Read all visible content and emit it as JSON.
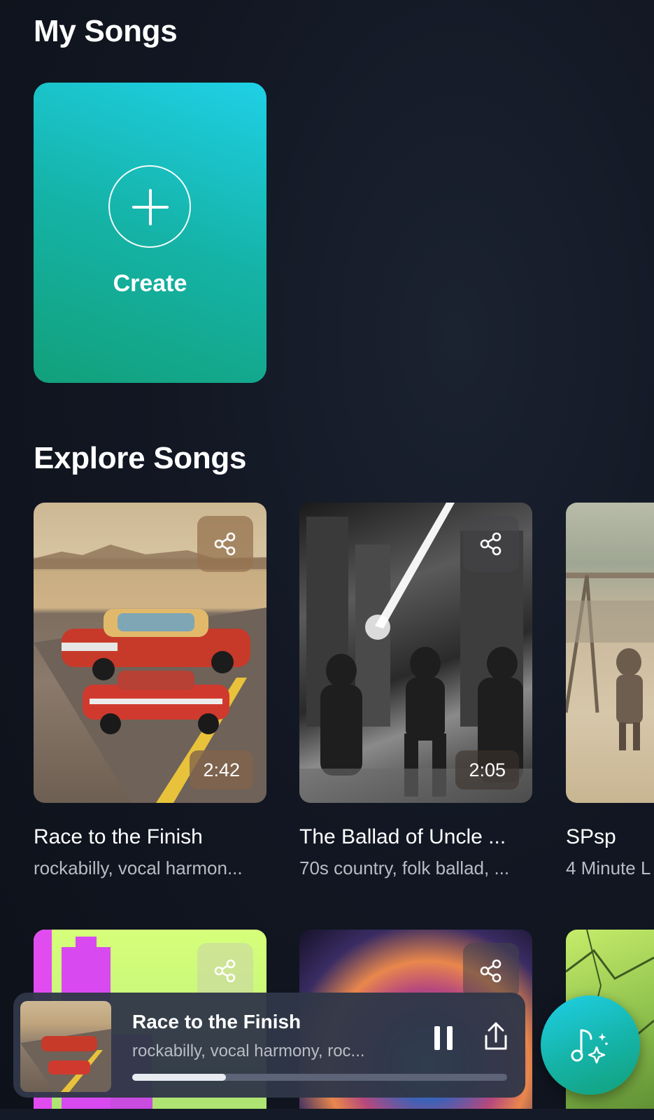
{
  "my_songs": {
    "title": "My Songs",
    "create_label": "Create"
  },
  "explore": {
    "title": "Explore Songs",
    "row1": [
      {
        "title": "Race to the Finish",
        "tags": "rockabilly, vocal harmon...",
        "duration": "2:42"
      },
      {
        "title": "The Ballad of Uncle ...",
        "tags": "70s country, folk ballad, ...",
        "duration": "2:05"
      },
      {
        "title": "SPsp",
        "tags": "4 Minute L"
      }
    ]
  },
  "player": {
    "title": "Race to the Finish",
    "tags": "rockabilly, vocal harmony, roc...",
    "progress": 0.25
  },
  "icons": {
    "share": "share-icon",
    "pause": "pause-icon",
    "upload": "upload-icon",
    "ai_music": "music-sparkle-icon"
  },
  "colors": {
    "accent_start": "#1fd0e6",
    "accent_end": "#12a07a"
  }
}
